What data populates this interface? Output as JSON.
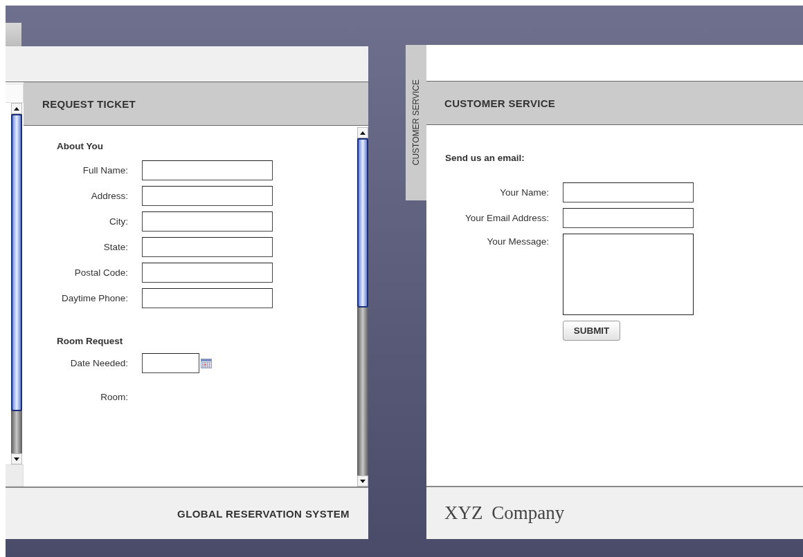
{
  "left_panel": {
    "title": "REQUEST TICKET",
    "sections": [
      {
        "heading": "About You",
        "fields": [
          {
            "label": "Full Name:",
            "kind": "text"
          },
          {
            "label": "Address:",
            "kind": "text"
          },
          {
            "label": "City:",
            "kind": "text"
          },
          {
            "label": "State:",
            "kind": "text"
          },
          {
            "label": "Postal Code:",
            "kind": "text"
          },
          {
            "label": "Daytime Phone:",
            "kind": "text"
          }
        ]
      },
      {
        "heading": "Room Request",
        "fields": [
          {
            "label": "Date Needed:",
            "kind": "date"
          },
          {
            "label": "Room:",
            "kind": "none"
          }
        ]
      }
    ],
    "footer": "GLOBAL RESERVATION SYSTEM"
  },
  "right_panel": {
    "side_tab": "CUSTOMER SERVICE",
    "title": "CUSTOMER SERVICE",
    "intro": "Send us an email:",
    "fields": [
      {
        "label": "Your Name:",
        "kind": "text"
      },
      {
        "label": "Your Email Address:",
        "kind": "text"
      },
      {
        "label": "Your Message:",
        "kind": "textarea"
      }
    ],
    "button": "SUBMIT",
    "footer": "XYZ Company"
  }
}
